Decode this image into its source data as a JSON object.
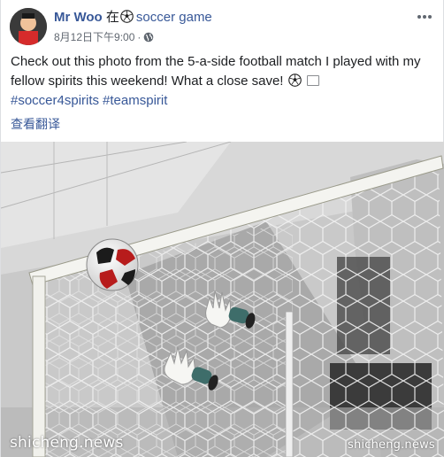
{
  "post": {
    "author": "Mr Woo",
    "at_word": "在",
    "place_icon": "soccer-ball-icon",
    "place": "soccer game",
    "date": "8月12日下午9:00",
    "separator": "·",
    "audience_icon": "globe-icon",
    "text": "Check out this photo from the 5-a-side football match I played with my fellow spirits this weekend! What a close save!",
    "text_emoji_icon": "soccer-ball-icon",
    "hashtags": [
      "#soccer4spirits",
      "#teamspirit"
    ],
    "translate_label": "查看翻译",
    "more_icon": "more-options-icon"
  },
  "photo": {
    "description_icon": "goal-save-photo",
    "watermark_left": "shicheng.news",
    "watermark_right": "shicheng.news"
  }
}
